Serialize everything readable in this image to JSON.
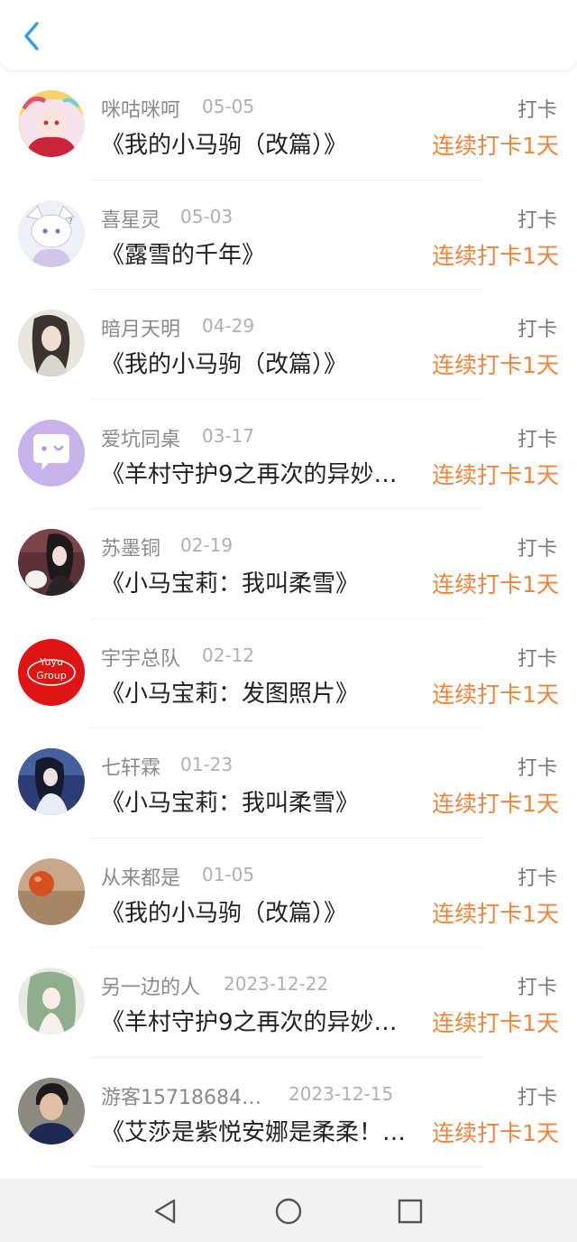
{
  "header": {
    "back_icon": "chevron-left-icon",
    "accent": "#3a9be0"
  },
  "items": [
    {
      "name": "咪咕咪呵",
      "date": "05-05",
      "title": "《我的小马驹（改篇）》",
      "checkin": "打卡",
      "streak": "连续打卡1天",
      "avatar": "avatar-anime-pink-hair"
    },
    {
      "name": "喜星灵",
      "date": "05-03",
      "title": "《露雪的千年》",
      "checkin": "打卡",
      "streak": "连续打卡1天",
      "avatar": "avatar-anime-white-animal"
    },
    {
      "name": "暗月天明",
      "date": "04-29",
      "title": "《我的小马驹（改篇）》",
      "checkin": "打卡",
      "streak": "连续打卡1天",
      "avatar": "avatar-ink-figure"
    },
    {
      "name": "爱坑同桌",
      "date": "03-17",
      "title": "《羊村守护9之再次的异妙…",
      "checkin": "打卡",
      "streak": "连续打卡1天",
      "avatar": "avatar-chat-bubble"
    },
    {
      "name": "苏墨铜",
      "date": "02-19",
      "title": "《小马宝莉：我叫柔雪》",
      "checkin": "打卡",
      "streak": "连续打卡1天",
      "avatar": "avatar-anime-birthday"
    },
    {
      "name": "宇宇总队",
      "date": "02-12",
      "title": "《小马宝莉：发图照片》",
      "checkin": "打卡",
      "streak": "连续打卡1天",
      "avatar": "avatar-yuyu-group",
      "avatar_text": "Yuyu Group"
    },
    {
      "name": "七轩霖",
      "date": "01-23",
      "title": "《小马宝莉：我叫柔雪》",
      "checkin": "打卡",
      "streak": "连续打卡1天",
      "avatar": "avatar-anime-blue"
    },
    {
      "name": "从来都是",
      "date": "01-05",
      "title": "《我的小马驹（改篇）》",
      "checkin": "打卡",
      "streak": "连续打卡1天",
      "avatar": "avatar-orange-ball"
    },
    {
      "name": "另一边的人",
      "date": "2023-12-22",
      "title": "《羊村守护9之再次的异妙…",
      "checkin": "打卡",
      "streak": "连续打卡1天",
      "avatar": "avatar-anime-green-hair"
    },
    {
      "name": "游客15718684…",
      "date": "2023-12-15",
      "title": "《艾莎是紫悦安娜是柔柔！…",
      "checkin": "打卡",
      "streak": "连续打卡1天",
      "avatar": "avatar-person-photo"
    }
  ],
  "navbar": {
    "back_icon": "triangle-back-icon",
    "home_icon": "circle-home-icon",
    "recents_icon": "square-recents-icon"
  },
  "colors": {
    "streak": "#f0843c",
    "name": "#8a8a8a",
    "date": "#b0b0b0",
    "title": "#222222"
  }
}
